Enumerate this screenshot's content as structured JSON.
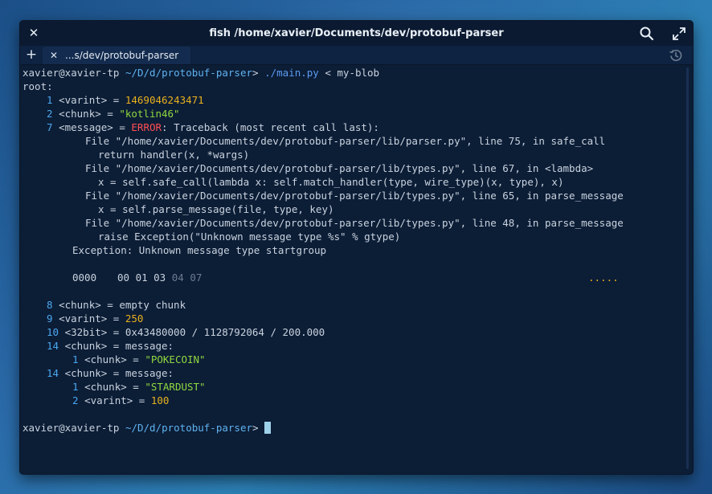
{
  "window": {
    "title": "fish  /home/xavier/Documents/dev/protobuf-parser",
    "tab_label": "...s/dev/protobuf-parser"
  },
  "icons": {
    "close": "close-icon",
    "search": "search-icon",
    "maximize": "maximize-icon",
    "new_tab": "plus-icon",
    "history": "history-icon"
  },
  "colors": {
    "background": "#0c1d36",
    "titlebar": "#0b1a31",
    "text": "#c9d3de",
    "path": "#5fb3f0",
    "number": "#4aa8f0",
    "yellow": "#e8b11d",
    "green": "#8fd83f",
    "red": "#ff4e54"
  },
  "terminal": {
    "prompt_user": "xavier@xavier-tp",
    "prompt_path": "~/D/d/protobuf-parser",
    "prompt_symbol": ">",
    "command": "./main.py",
    "command_args": "< my-blob",
    "root_label": "root:",
    "f1_num": "1",
    "f1_key": "<varint> =",
    "f1_val": "1469046243471",
    "f2_num": "2",
    "f2_key": "<chunk> =",
    "f2_val": "\"kotlin46\"",
    "f7_num": "7",
    "f7_key": "<message> =",
    "f7_err": "ERROR",
    "f7_rest": ": Traceback (most recent call last):",
    "tb1": "File \"/home/xavier/Documents/dev/protobuf-parser/lib/parser.py\", line 75, in safe_call",
    "tb2": "return handler(x, *wargs)",
    "tb3": "File \"/home/xavier/Documents/dev/protobuf-parser/lib/types.py\", line 67, in <lambda>",
    "tb4": "x = self.safe_call(lambda x: self.match_handler(type, wire_type)(x, type), x)",
    "tb5": "File \"/home/xavier/Documents/dev/protobuf-parser/lib/types.py\", line 65, in parse_message",
    "tb6": "x = self.parse_message(file, type, key)",
    "tb7": "File \"/home/xavier/Documents/dev/protobuf-parser/lib/types.py\", line 48, in parse_message",
    "tb8": "raise Exception(\"Unknown message type %s\" % gtype)",
    "tb9": "Exception: Unknown message type startgroup",
    "hex_offset": "0000",
    "hex_bytes": "00 01 03",
    "hex_bytes_dim": "04 07",
    "hex_ascii": ".....",
    "f8_num": "8",
    "f8_rest": "<chunk> = empty chunk",
    "f9_num": "9",
    "f9_key": "<varint> =",
    "f9_val": "250",
    "f10_num": "10",
    "f10_rest": "<32bit> = 0x43480000 / 1128792064 / 200.000",
    "f14a_num": "14",
    "f14a_rest": "<chunk> = message:",
    "f14a_1_num": "1",
    "f14a_1_key": "<chunk> =",
    "f14a_1_val": "\"POKECOIN\"",
    "f14b_num": "14",
    "f14b_rest": "<chunk> = message:",
    "f14b_1_num": "1",
    "f14b_1_key": "<chunk> =",
    "f14b_1_val": "\"STARDUST\"",
    "f14b_2_num": "2",
    "f14b_2_key": "<varint> =",
    "f14b_2_val": "100"
  }
}
